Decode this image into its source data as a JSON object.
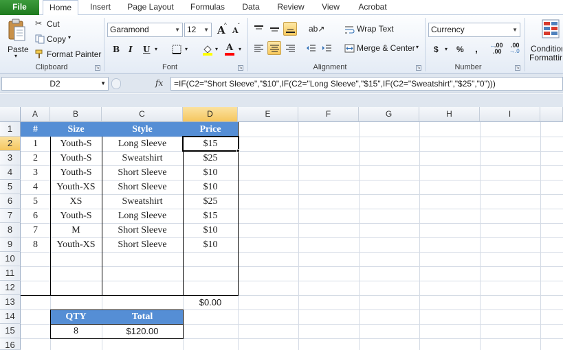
{
  "ribbon": {
    "tabs": [
      "File",
      "Home",
      "Insert",
      "Page Layout",
      "Formulas",
      "Data",
      "Review",
      "View",
      "Acrobat"
    ],
    "active_tab": "Home",
    "clipboard": {
      "paste": "Paste",
      "cut": "Cut",
      "copy": "Copy",
      "format_painter": "Format Painter",
      "label": "Clipboard"
    },
    "font": {
      "name": "Garamond",
      "size": "12",
      "label": "Font",
      "bold": "B",
      "italic": "I",
      "underline": "U",
      "grow": "A",
      "shrink": "A",
      "font_color": "A",
      "fill_color_hex": "#ffff00",
      "font_color_hex": "#ff0000"
    },
    "alignment": {
      "wrap_text": "Wrap Text",
      "merge_center": "Merge & Center",
      "label": "Alignment"
    },
    "number": {
      "format": "Currency",
      "label": "Number",
      "currency": "$",
      "percent": "%",
      "comma": ",",
      "inc_decimal": ".00",
      "dec_decimal": ".00"
    },
    "styles": {
      "conditional_line1": "Condition",
      "conditional_line2": "Formattin"
    }
  },
  "formula_bar": {
    "name_box": "D2",
    "fx": "fx",
    "formula": "=IF(C2=\"Short Sleeve\",\"$10\",IF(C2=\"Long Sleeve\",\"$15\",IF(C2=\"Sweatshirt\",\"$25\",\"0\")))"
  },
  "sheet": {
    "columns": [
      "A",
      "B",
      "C",
      "D",
      "E",
      "F",
      "G",
      "H",
      "I"
    ],
    "rows": [
      "1",
      "2",
      "3",
      "4",
      "5",
      "6",
      "7",
      "8",
      "9",
      "10",
      "11",
      "12",
      "13",
      "14",
      "15",
      "16"
    ],
    "selected_cell": "D2",
    "table_headers": [
      "#",
      "Size",
      "Style",
      "Price"
    ],
    "table_rows": [
      [
        "1",
        "Youth-S",
        "Long Sleeve",
        "$15"
      ],
      [
        "2",
        "Youth-S",
        "Sweatshirt",
        "$25"
      ],
      [
        "3",
        "Youth-S",
        "Short Sleeve",
        "$10"
      ],
      [
        "4",
        "Youth-XS",
        "Short Sleeve",
        "$10"
      ],
      [
        "5",
        "XS",
        "Sweatshirt",
        "$25"
      ],
      [
        "6",
        "Youth-S",
        "Long Sleeve",
        "$15"
      ],
      [
        "7",
        "M",
        "Short Sleeve",
        "$10"
      ],
      [
        "8",
        "Youth-XS",
        "Short Sleeve",
        "$10"
      ]
    ],
    "d13_total": "$0.00",
    "summary_headers": [
      "QTY",
      "Total"
    ],
    "summary_values": [
      "8",
      "$120.00"
    ],
    "header_fill_hex": "#558ed5"
  }
}
